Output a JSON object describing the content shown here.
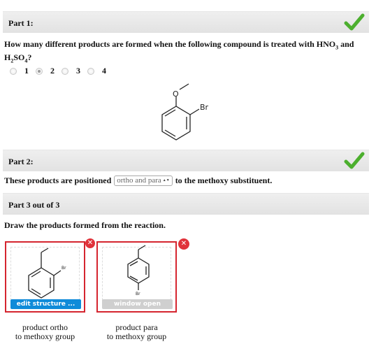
{
  "part1": {
    "title": "Part 1:",
    "question_pre": "How many different products are formed when the following compound is treated with HNO",
    "question_sub3": "3",
    "question_and": " and",
    "question_h": "H",
    "question_sub2": "2",
    "question_so": "SO",
    "question_sub4": "4",
    "question_end": "?",
    "options": [
      "1",
      "2",
      "3",
      "4"
    ],
    "selected_index": 1,
    "molecule": {
      "substituent_top": "O",
      "substituent_right": "Br"
    }
  },
  "part2": {
    "title": "Part 2:",
    "sentence_pre": "These products are positioned",
    "dropdown_value": "ortho and para",
    "sentence_post": "to the methoxy substituent."
  },
  "part3": {
    "title": "Part 3 out of 3",
    "instruction": "Draw the products formed from the reaction.",
    "box1": {
      "button": "edit structure ...",
      "label_br": "Br",
      "caption_line1": "product ortho",
      "caption_line2": "to methoxy group"
    },
    "box2": {
      "button": "window open",
      "label_br": "Br",
      "caption_line1": "product para",
      "caption_line2": "to methoxy group"
    }
  },
  "icons": {
    "complete": "checkmark-icon",
    "remove": "close-icon"
  },
  "colors": {
    "check_green": "#4caf2e",
    "accent_red": "#d5252f",
    "button_blue": "#0f8bd9"
  }
}
